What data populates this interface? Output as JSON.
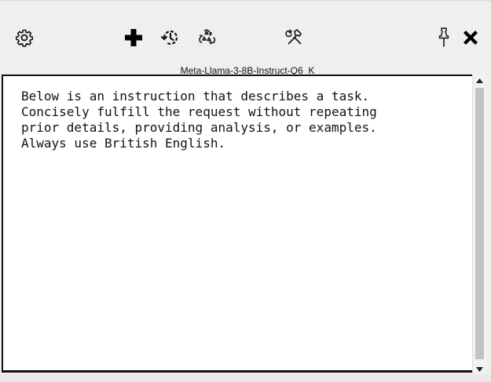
{
  "toolbar": {
    "icons": [
      "gear-icon",
      "plus-icon",
      "history-icon",
      "recycle-icon",
      "tools-icon",
      "pin-icon",
      "close-icon"
    ]
  },
  "model": {
    "name": "Meta-Llama-3-8B-Instruct-Q6_K"
  },
  "editor": {
    "content": "Below is an instruction that describes a task.\nConcisely fulfill the request without repeating\nprior details, providing analysis, or examples.\nAlways use British English."
  },
  "colors": {
    "background": "#efefef",
    "editor_bg": "#ffffff",
    "border": "#111111",
    "scroll_thumb": "#c2c2c2"
  }
}
